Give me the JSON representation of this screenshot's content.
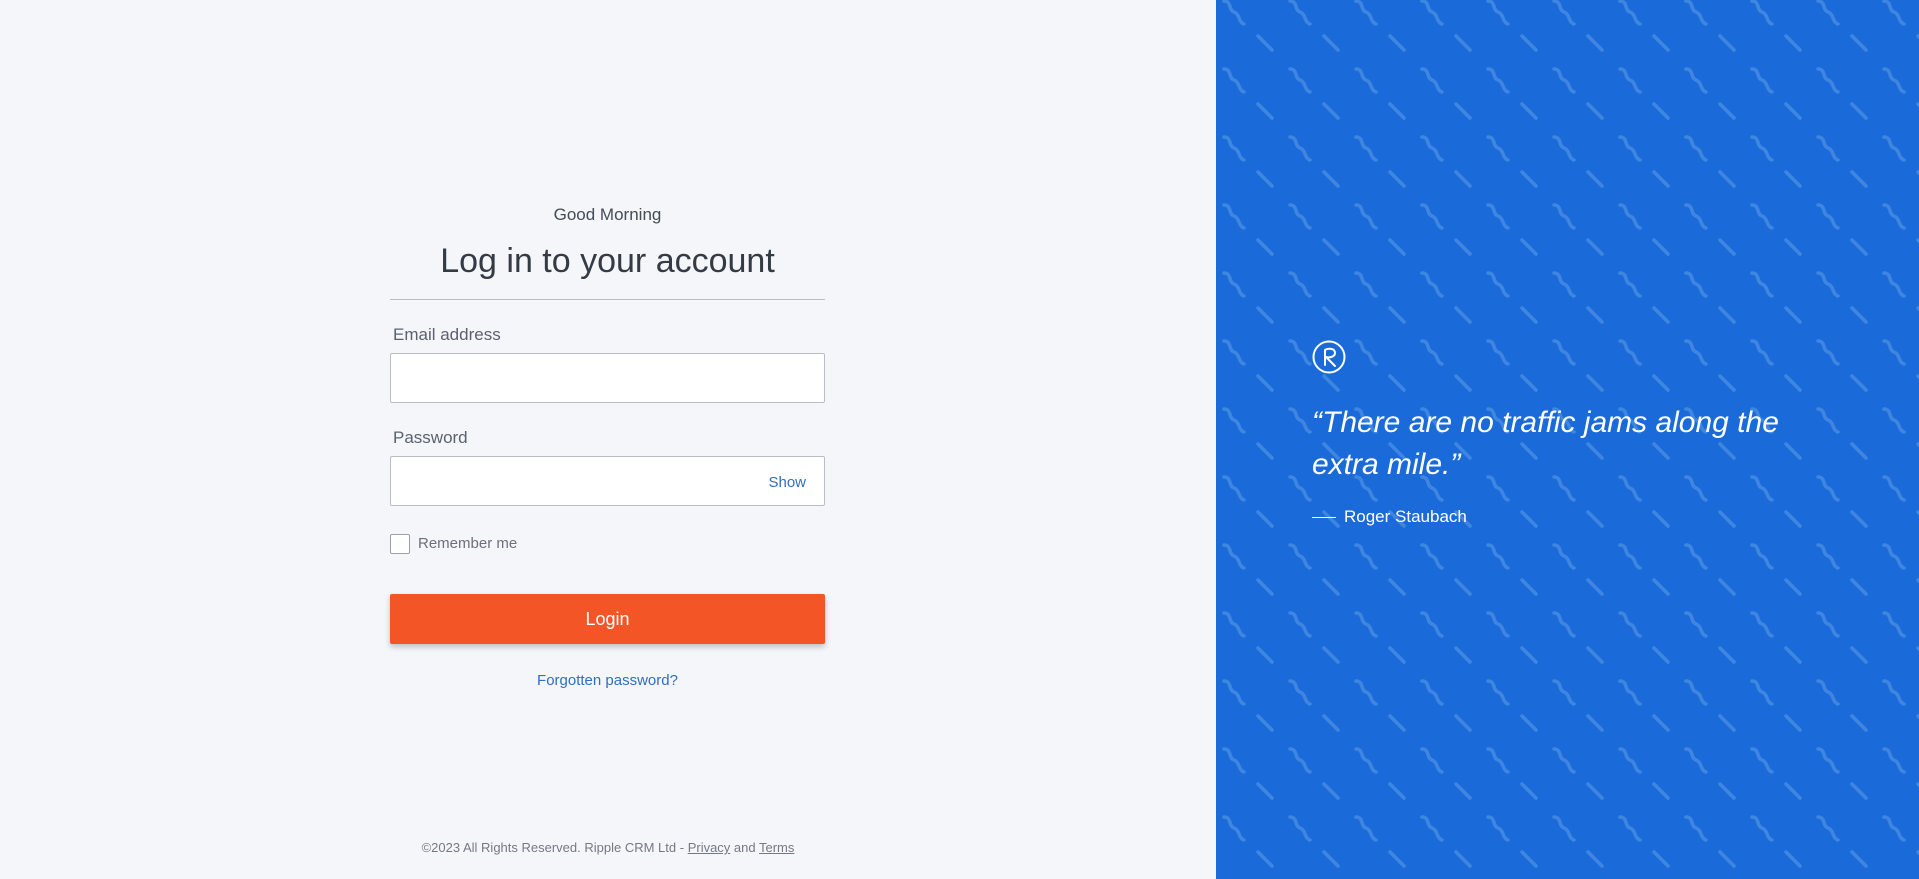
{
  "login": {
    "greeting": "Good Morning",
    "headline": "Log in to your account",
    "email_label": "Email address",
    "email_value": "",
    "password_label": "Password",
    "password_value": "",
    "show_toggle": "Show",
    "remember_label": "Remember me",
    "remember_checked": false,
    "login_button": "Login",
    "forgot_link": "Forgotten password?"
  },
  "footer": {
    "copyright": "©2023 All Rights Reserved. Ripple CRM Ltd - ",
    "privacy": "Privacy",
    "and": " and ",
    "terms": "Terms"
  },
  "quote": {
    "text": "“There are no traffic jams along the extra mile.”",
    "author": "Roger Staubach",
    "logo_icon": "ripple-r-logo-icon"
  },
  "colors": {
    "page_bg": "#f4f6fa",
    "panel_blue": "#1a6ad9",
    "pattern_blue": "#3f86e0",
    "login_orange": "#f35527",
    "link_blue": "#2f6ec0"
  }
}
